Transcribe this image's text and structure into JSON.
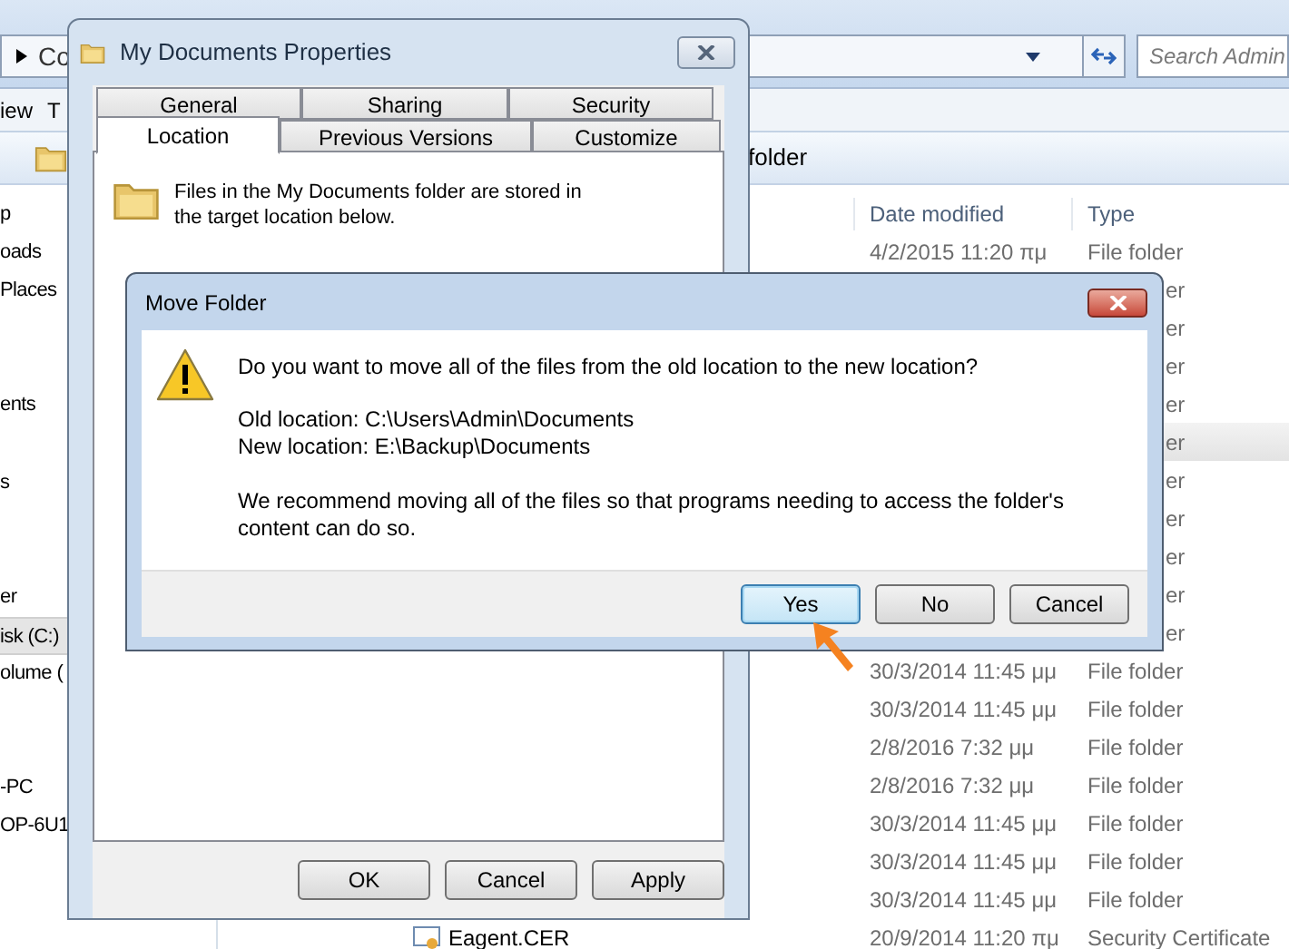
{
  "explorer": {
    "address": "Co",
    "search": {
      "placeholder": "Search Admin"
    },
    "menu": [
      "iew",
      "T"
    ],
    "toolbar_text": "folder",
    "nav_items": [
      {
        "label": "p",
        "selected": false
      },
      {
        "label": "oads",
        "selected": false
      },
      {
        "label": "Places",
        "selected": false
      },
      {
        "label": "ents",
        "selected": false
      },
      {
        "label": "s",
        "selected": false
      },
      {
        "label": "er",
        "selected": false
      },
      {
        "label": "isk (C:)",
        "selected": true
      },
      {
        "label": "olume (",
        "selected": false
      },
      {
        "label": "-PC",
        "selected": false
      },
      {
        "label": "OP-6U1",
        "selected": false
      }
    ],
    "columns": [
      "Date modified",
      "Type"
    ],
    "rows": [
      {
        "date": "4/2/2015 11:20 πμ",
        "type": "File folder",
        "selected": false
      },
      {
        "type": "er",
        "selected": false
      },
      {
        "type": "er",
        "selected": false
      },
      {
        "type": "er",
        "selected": false
      },
      {
        "type": "er",
        "selected": false
      },
      {
        "type": "er",
        "selected": true
      },
      {
        "type": "er",
        "selected": false
      },
      {
        "type": "er",
        "selected": false
      },
      {
        "type": "er",
        "selected": false
      },
      {
        "type": "er",
        "selected": false
      },
      {
        "type": "er",
        "selected": false
      },
      {
        "date": "30/3/2014 11:45 μμ",
        "type": "File folder",
        "selected": false
      },
      {
        "date": "30/3/2014 11:45 μμ",
        "type": "File folder",
        "selected": false
      },
      {
        "date": "2/8/2016 7:32 μμ",
        "type": "File folder",
        "selected": false
      },
      {
        "date": "2/8/2016 7:32 μμ",
        "type": "File folder",
        "selected": false
      },
      {
        "date": "30/3/2014 11:45 μμ",
        "type": "File folder",
        "selected": false
      },
      {
        "date": "30/3/2014 11:45 μμ",
        "type": "File folder",
        "selected": false
      },
      {
        "date": "30/3/2014 11:45 μμ",
        "type": "File folder",
        "selected": false
      },
      {
        "name": "Eagent.CER",
        "date": "20/9/2014 11:20 πμ",
        "type": "Security Certificate",
        "selected": false
      }
    ]
  },
  "properties_dialog": {
    "title": "My Documents Properties",
    "tab_rows": [
      [
        {
          "label": "General",
          "selected": false
        },
        {
          "label": "Sharing",
          "selected": false
        },
        {
          "label": "Security",
          "selected": false
        }
      ],
      [
        {
          "label": "Location",
          "selected": true
        },
        {
          "label": "Previous Versions",
          "selected": false
        },
        {
          "label": "Customize",
          "selected": false
        }
      ]
    ],
    "description": "Files in the My Documents folder are stored in the target location below.",
    "buttons": [
      "OK",
      "Cancel",
      "Apply"
    ]
  },
  "move_dialog": {
    "title": "Move Folder",
    "question": "Do you want to move all of the files from the old location to the new location?",
    "old_location": "Old location: C:\\Users\\Admin\\Documents",
    "new_location": "New location: E:\\Backup\\Documents",
    "recommendation": "We recommend moving all of the files so that programs needing to access the folder's content can do so.",
    "buttons": [
      {
        "label": "Yes",
        "focused": true
      },
      {
        "label": "No",
        "focused": false
      },
      {
        "label": "Cancel",
        "focused": false
      }
    ]
  }
}
